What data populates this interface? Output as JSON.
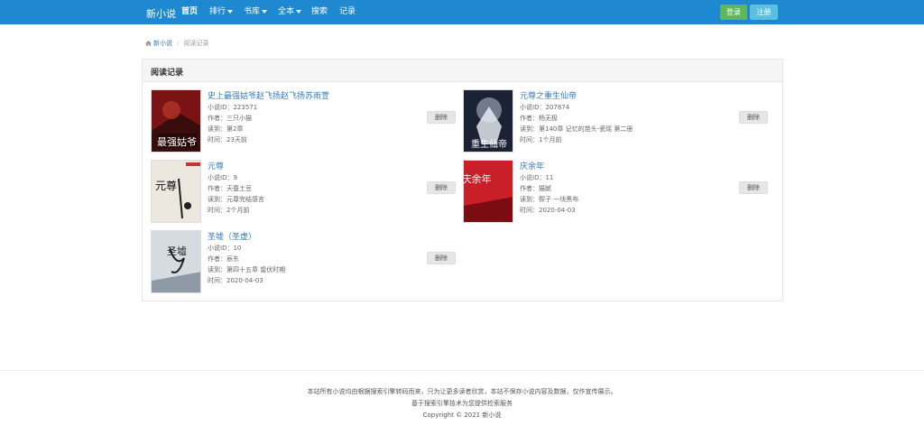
{
  "navbar": {
    "brand": "新小说",
    "items": [
      {
        "label": "首页"
      },
      {
        "label": "排行"
      },
      {
        "label": "书库"
      },
      {
        "label": "全本"
      },
      {
        "label": "搜索"
      },
      {
        "label": "记录"
      }
    ],
    "login": "登录",
    "register": "注册"
  },
  "breadcrumb": {
    "home": "新小说",
    "current": "阅读记录"
  },
  "panel": {
    "title": "阅读记录"
  },
  "books": [
    {
      "title": "史上最强姑爷赵飞扬赵飞扬苏雨萱",
      "id": "小说ID：223571",
      "author": "作者：三只小猫",
      "read": "读到：第2章",
      "time": "时间：23天前",
      "delete": "删除",
      "cover_text": "最强姑爷",
      "cover_color": "#8b1a1a"
    },
    {
      "title": "元尊之重生仙帝",
      "id": "小说ID：207874",
      "author": "作者：杨无极",
      "read": "读到：第140章 记忆的苗头-瓷瑶 第二册",
      "time": "时间：1个月前",
      "delete": "删除",
      "cover_text": "重生仙帝",
      "cover_color": "#2a3550"
    },
    {
      "title": "元尊",
      "id": "小说ID：9",
      "author": "作者：天蚕土豆",
      "read": "读到：元尊完结感言",
      "time": "时间：2个月前",
      "delete": "删除",
      "cover_text": "元尊",
      "cover_color": "#e8e4dc"
    },
    {
      "title": "庆余年",
      "id": "小说ID：11",
      "author": "作者：猫腻",
      "read": "读到：楔子 一块黑布",
      "time": "时间：2020-04-03",
      "delete": "删除",
      "cover_text": "庆余年",
      "cover_color": "#c8222b"
    },
    {
      "title": "圣墟（圣虚）",
      "id": "小说ID：10",
      "author": "作者：辰东",
      "read": "读到：第四十五章 蛰伏时期",
      "time": "时间：2020-04-03",
      "delete": "删除",
      "cover_text": "圣墟",
      "cover_color": "#d8dde2"
    }
  ],
  "footer": {
    "line1": "本站所有小说均由根据搜索引擎转码而来，只为让更多读者欣赏，本站不保存小说内容及数据，仅作宣传展示。",
    "line2": "基于搜索引擎技术为您提供检索服务",
    "line3": "Copyright © 2021 新小说"
  }
}
